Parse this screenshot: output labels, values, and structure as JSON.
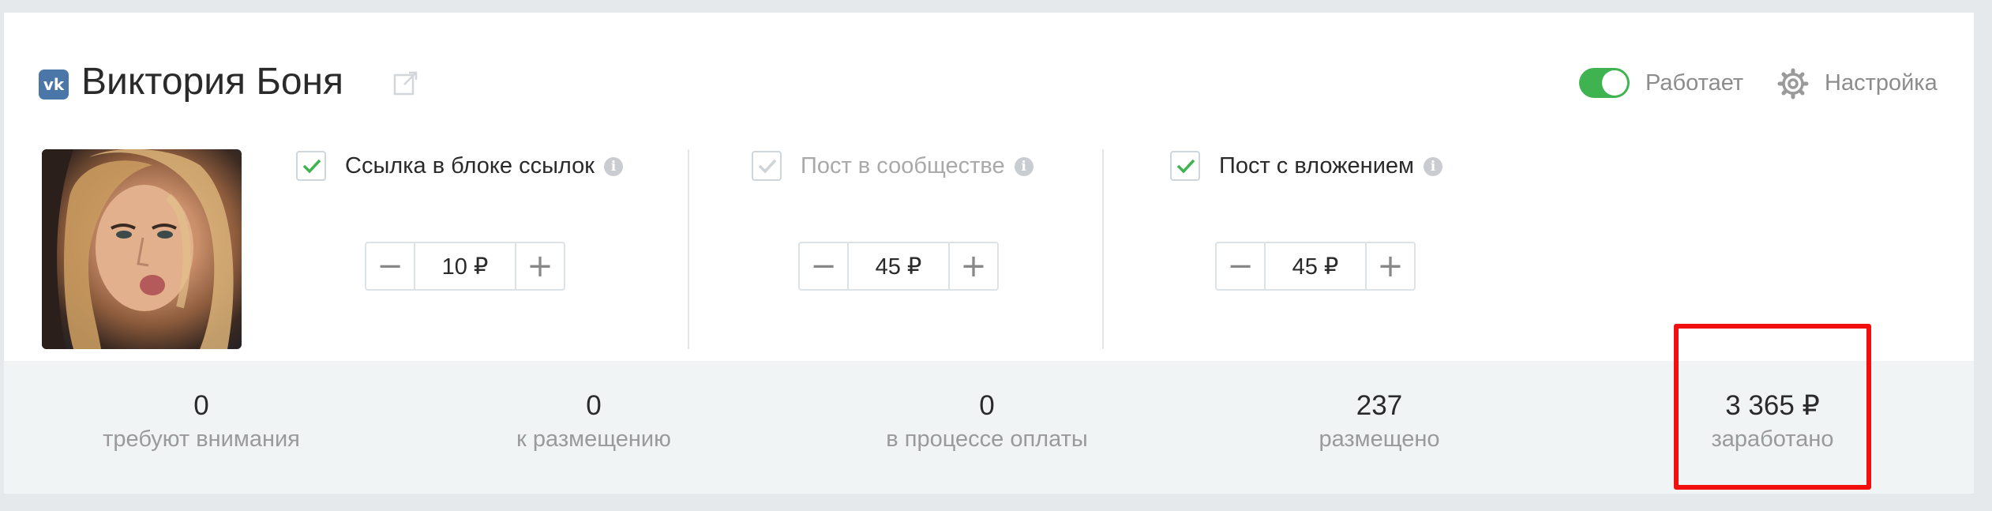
{
  "header": {
    "network_icon": "vk-logo-icon",
    "network_glyph": "vk",
    "title": "Виктория Боня",
    "external_link_icon": "external-link-icon",
    "toggle_state": "on",
    "status_label": "Работает",
    "settings_label": "Настройка",
    "accent_color": "#3fb34f"
  },
  "options": [
    {
      "label": "Ссылка в блоке ссылок",
      "checked": true,
      "enabled": true,
      "value": "10 ₽"
    },
    {
      "label": "Пост в сообществе",
      "checked": true,
      "enabled": false,
      "value": "45 ₽"
    },
    {
      "label": "Пост с вложением",
      "checked": true,
      "enabled": true,
      "value": "45 ₽"
    }
  ],
  "info_glyph": "i",
  "stepper": {
    "minus": "−",
    "plus": "+"
  },
  "stats": [
    {
      "value": "0",
      "label": "требуют внимания"
    },
    {
      "value": "0",
      "label": "к размещению"
    },
    {
      "value": "0",
      "label": "в процессе оплаты"
    },
    {
      "value": "237",
      "label": "размещено"
    },
    {
      "value": "3 365 ₽",
      "label": "заработано"
    }
  ],
  "highlight_color": "#f10f0f"
}
